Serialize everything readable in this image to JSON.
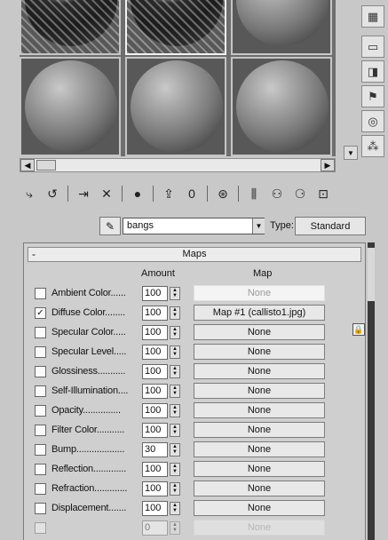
{
  "toolbar_right": [
    {
      "icon": "checker-background-icon",
      "glyph": "▦"
    },
    {
      "icon": "backlight-icon",
      "glyph": "▭"
    },
    {
      "icon": "sample-uv-tiling-icon",
      "glyph": "◨"
    },
    {
      "icon": "video-color-check-icon",
      "glyph": "⚑"
    },
    {
      "icon": "make-preview-icon",
      "glyph": "◎"
    },
    {
      "icon": "options-icon",
      "glyph": "⁂"
    }
  ],
  "material_toolbar": [
    {
      "icon": "get-material-icon",
      "glyph": "⤷"
    },
    {
      "icon": "put-material-icon",
      "glyph": "↺"
    },
    {
      "icon": "assign-material-icon",
      "glyph": "⇥"
    },
    {
      "icon": "reset-map-icon",
      "glyph": "✕"
    },
    {
      "icon": "make-unique-icon",
      "glyph": "●"
    },
    {
      "icon": "put-to-library-icon",
      "glyph": "⇪"
    },
    {
      "icon": "material-id-icon",
      "glyph": "0"
    },
    {
      "icon": "show-map-in-viewport-icon",
      "glyph": "⊛"
    },
    {
      "icon": "show-end-result-icon",
      "glyph": "⫼"
    },
    {
      "icon": "go-to-parent-icon",
      "glyph": "⚇"
    },
    {
      "icon": "go-forward-to-sibling-icon",
      "glyph": "⚆"
    },
    {
      "icon": "material-map-navigator-icon",
      "glyph": "⊡"
    }
  ],
  "name_row": {
    "pick_icon": "eyedropper-icon",
    "material_name": "bangs",
    "type_label": "Type:",
    "type_value": "Standard"
  },
  "maps": {
    "title": "Maps",
    "collapse_glyph": "-",
    "amount_header": "Amount",
    "map_header": "Map",
    "rows": [
      {
        "label": "Ambient Color......",
        "checked": false,
        "amount": "100",
        "map": "None",
        "dim": true
      },
      {
        "label": "Diffuse Color........",
        "checked": true,
        "amount": "100",
        "map": "Map #1 (callisto1.jpg)",
        "dim": false
      },
      {
        "label": "Specular Color.....",
        "checked": false,
        "amount": "100",
        "map": "None",
        "dim": false
      },
      {
        "label": "Specular Level.....",
        "checked": false,
        "amount": "100",
        "map": "None",
        "dim": false
      },
      {
        "label": "Glossiness...........",
        "checked": false,
        "amount": "100",
        "map": "None",
        "dim": false
      },
      {
        "label": "Self-Illumination....",
        "checked": false,
        "amount": "100",
        "map": "None",
        "dim": false
      },
      {
        "label": "Opacity...............",
        "checked": false,
        "amount": "100",
        "map": "None",
        "dim": false
      },
      {
        "label": "Filter Color...........",
        "checked": false,
        "amount": "100",
        "map": "None",
        "dim": false
      },
      {
        "label": "Bump...................",
        "checked": false,
        "amount": "30",
        "map": "None",
        "dim": false
      },
      {
        "label": "Reflection.............",
        "checked": false,
        "amount": "100",
        "map": "None",
        "dim": false
      },
      {
        "label": "Refraction.............",
        "checked": false,
        "amount": "100",
        "map": "None",
        "dim": false
      },
      {
        "label": "Displacement.......",
        "checked": false,
        "amount": "100",
        "map": "None",
        "dim": false
      },
      {
        "label": "",
        "checked": false,
        "amount": "0",
        "map": "None",
        "dim": true
      }
    ]
  }
}
